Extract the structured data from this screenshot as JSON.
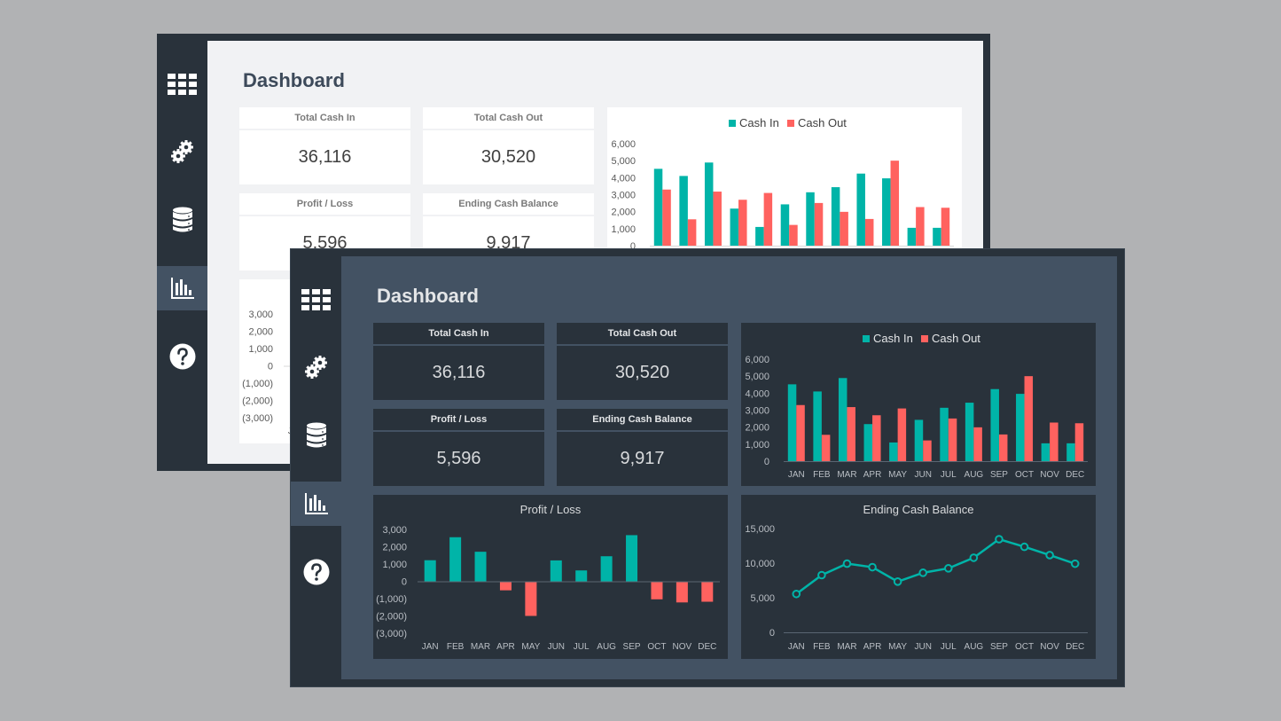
{
  "theme_colors": {
    "cash_in": "#00b4a8",
    "cash_out": "#ff625f",
    "dark_frame": "#29323b",
    "dark_content": "#435263",
    "light_content": "#f1f2f4",
    "page_background": "#b1b2b4"
  },
  "sidebar": {
    "items": [
      {
        "name": "grid-icon",
        "label": "Dashboard grid",
        "active": false
      },
      {
        "name": "gears-icon",
        "label": "Settings",
        "active": false
      },
      {
        "name": "database-icon",
        "label": "Data",
        "active": false
      },
      {
        "name": "bar-chart-icon",
        "label": "Charts",
        "active": true
      },
      {
        "name": "help-icon",
        "label": "Help",
        "active": false
      }
    ]
  },
  "dashboard": {
    "title": "Dashboard",
    "cards": [
      {
        "label": "Total Cash In",
        "value": "36,116"
      },
      {
        "label": "Total Cash Out",
        "value": "30,520"
      },
      {
        "label": "Profit / Loss",
        "value": "5,596"
      },
      {
        "label": "Ending Cash Balance",
        "value": "9,917"
      }
    ]
  },
  "chart_data": [
    {
      "type": "bar",
      "title": "",
      "categories": [
        "JAN",
        "FEB",
        "MAR",
        "APR",
        "MAY",
        "JUN",
        "JUL",
        "AUG",
        "SEP",
        "OCT",
        "NOV",
        "DEC"
      ],
      "series": [
        {
          "name": "Cash In",
          "values": [
            4520,
            4100,
            4890,
            2180,
            1100,
            2430,
            3140,
            3440,
            4240,
            3960,
            1050,
            1050
          ]
        },
        {
          "name": "Cash Out",
          "values": [
            3300,
            1550,
            3180,
            2700,
            3100,
            1220,
            2510,
            1990,
            1570,
            5000,
            2270,
            2230
          ]
        }
      ],
      "yticks": [
        "0",
        "1,000",
        "2,000",
        "3,000",
        "4,000",
        "5,000",
        "6,000"
      ],
      "ylim": [
        0,
        6000
      ],
      "legend": "top-center",
      "grid": false
    },
    {
      "type": "bar",
      "title": "Profit / Loss",
      "categories": [
        "JAN",
        "FEB",
        "MAR",
        "APR",
        "MAY",
        "JUN",
        "JUL",
        "AUG",
        "SEP",
        "OCT",
        "NOV",
        "DEC"
      ],
      "values": [
        1220,
        2550,
        1710,
        -520,
        -2000,
        1210,
        630,
        1450,
        2670,
        -1040,
        -1220,
        -1180
      ],
      "yticks": [
        "(3,000)",
        "(2,000)",
        "(1,000)",
        "0",
        "1,000",
        "2,000",
        "3,000"
      ],
      "ylim": [
        -3000,
        3000
      ],
      "grid": false
    },
    {
      "type": "line",
      "title": "Ending Cash Balance",
      "categories": [
        "JAN",
        "FEB",
        "MAR",
        "APR",
        "MAY",
        "JUN",
        "JUL",
        "AUG",
        "SEP",
        "OCT",
        "NOV",
        "DEC"
      ],
      "values": [
        5540,
        8270,
        9930,
        9420,
        7330,
        8610,
        9250,
        10780,
        13460,
        12360,
        11160,
        9917
      ],
      "yticks": [
        "0",
        "5,000",
        "10,000",
        "15,000"
      ],
      "ylim": [
        0,
        15000
      ],
      "grid": false
    }
  ]
}
